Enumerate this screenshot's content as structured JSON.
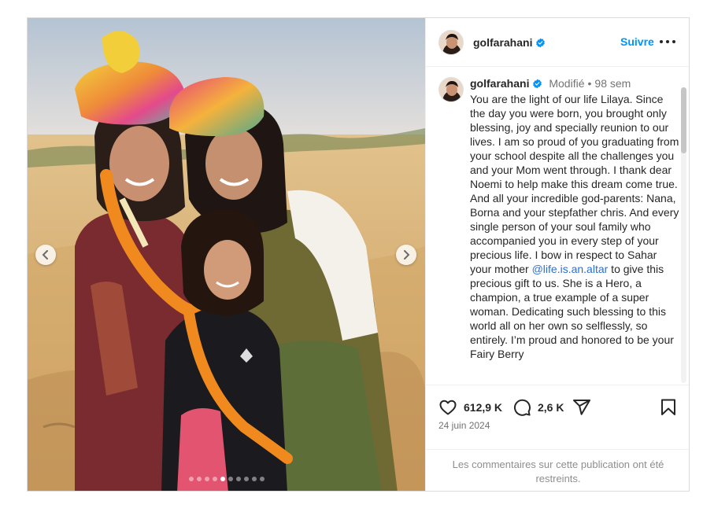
{
  "media": {
    "prev_icon": "chevron-left-icon",
    "next_icon": "chevron-right-icon",
    "slide_count": 10,
    "active_slide": 4
  },
  "header": {
    "username": "golfarahani",
    "verified": true,
    "follow_label": "Suivre",
    "more_icon": "more-horizontal-icon"
  },
  "caption": {
    "username": "golfarahani",
    "edited_label": "Modifié",
    "separator": "•",
    "age": "98 sem",
    "text_before_mention": "You are the light of our life Lilaya. Since the day you were born, you brought only blessing, joy and specially reunion to our lives. I am so proud of you graduating from your school despite all the challenges you and your Mom went through. I thank dear Noemi to help make this dream come true. And all your incredible god-parents: Nana, Borna and your stepfather chris. And every single person of your soul family who accompanied you in every step of your precious life. I bow in respect to Sahar your mother ",
    "mention": "@life.is.an.altar",
    "text_after_mention": " to give this precious gift to us. She is a Hero, a champion, a true example of a super woman. Dedicating such blessing to this world all on her own so selflessly, so entirely. I’m proud and honored to be your Fairy Berry"
  },
  "actions": {
    "like_icon": "heart-icon",
    "like_count": "612,9 K",
    "comment_icon": "comment-icon",
    "comment_count": "2,6 K",
    "share_icon": "paper-plane-icon",
    "save_icon": "bookmark-icon",
    "date": "24 juin 2024"
  },
  "comments": {
    "restricted_notice": "Les commentaires sur cette publication ont été restreints."
  },
  "colors": {
    "accent": "#0095f6",
    "verified": "#0095f6",
    "muted": "#737373"
  }
}
